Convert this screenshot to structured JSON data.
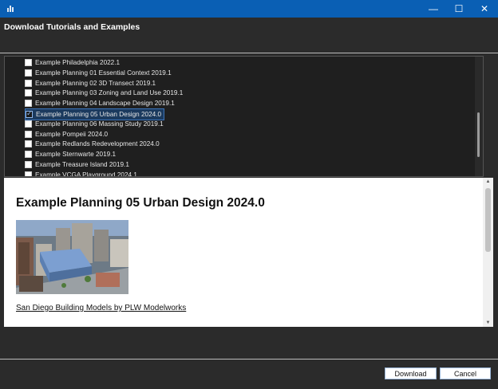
{
  "window": {
    "minimize_glyph": "—",
    "maximize_glyph": "☐",
    "close_glyph": "✕",
    "title_bar_color": "#0a5fb4"
  },
  "dialog": {
    "title": "Download Tutorials and Examples"
  },
  "list": {
    "items": [
      {
        "label": "Example Philadelphia 2022.1",
        "checked": false
      },
      {
        "label": "Example Planning 01 Essential Context 2019.1",
        "checked": false
      },
      {
        "label": "Example Planning 02 3D Transect 2019.1",
        "checked": false
      },
      {
        "label": "Example Planning 03 Zoning and Land Use 2019.1",
        "checked": false
      },
      {
        "label": "Example Planning 04 Landscape Design 2019.1",
        "checked": false
      },
      {
        "label": "Example Planning 05 Urban Design 2024.0",
        "checked": true,
        "selected": true
      },
      {
        "label": "Example Planning 06 Massing Study 2019.1",
        "checked": false
      },
      {
        "label": "Example Pompeii 2024.0",
        "checked": false
      },
      {
        "label": "Example Redlands Redevelopment 2024.0",
        "checked": false
      },
      {
        "label": "Example Sternwarte 2019.1",
        "checked": false
      },
      {
        "label": "Example Treasure Island 2019.1",
        "checked": false
      },
      {
        "label": "Example VCGA Playground 2024.1",
        "checked": false
      }
    ]
  },
  "preview": {
    "title": "Example Planning 05 Urban Design 2024.0",
    "image_icon": "city-render-image",
    "link_text": "San Diego Building Models by PLW Modelworks"
  },
  "footer": {
    "download_label": "Download",
    "cancel_label": "Cancel"
  }
}
